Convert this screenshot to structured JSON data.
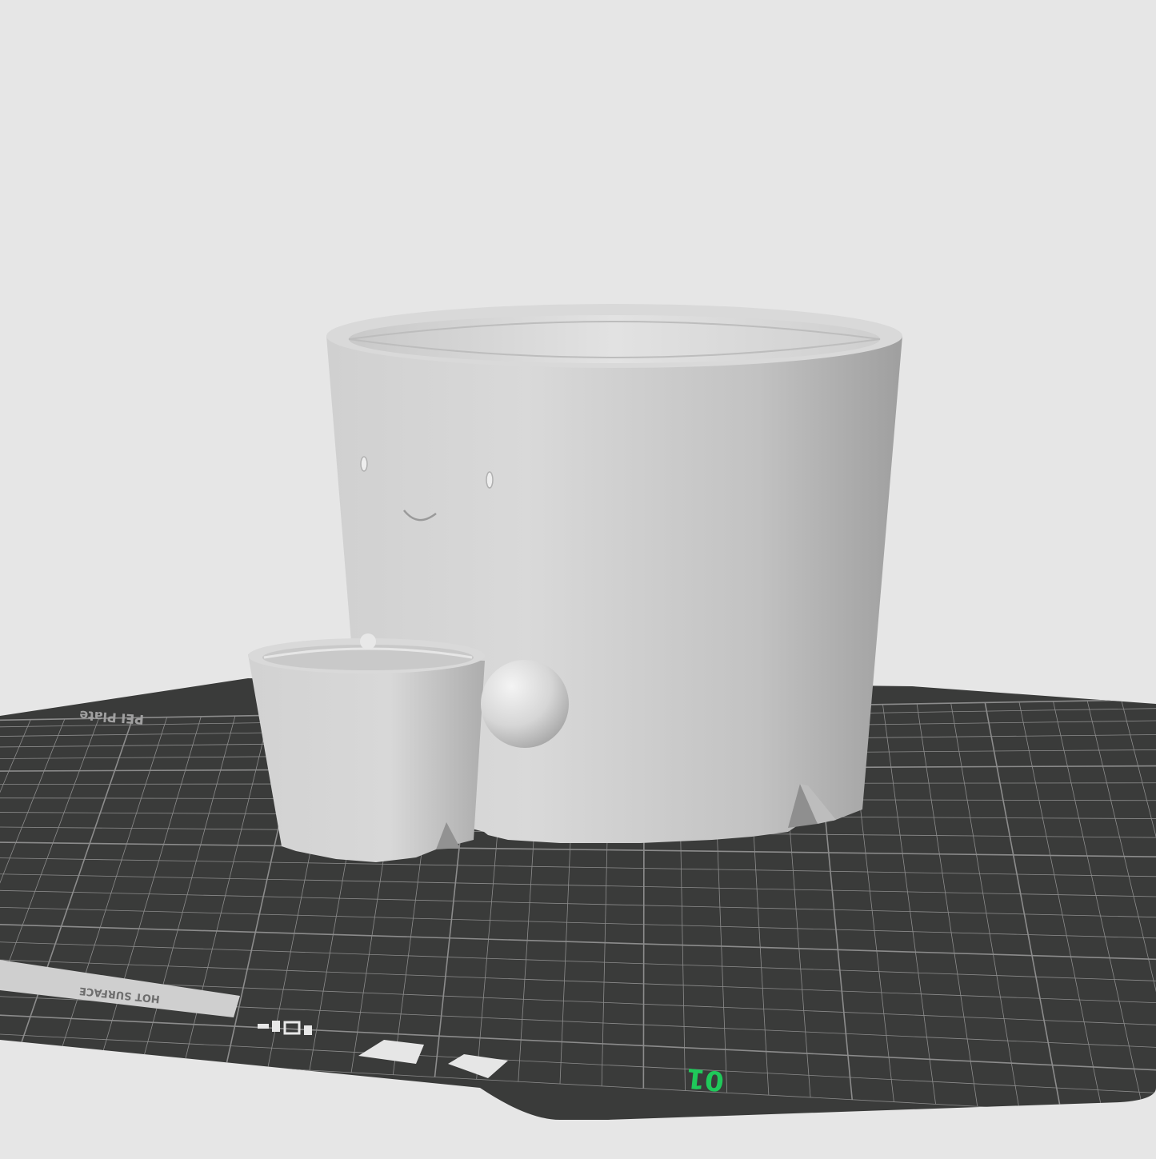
{
  "scene": {
    "background_color": "#e6e6e6",
    "bed_color": "#3a3b3a",
    "grid_color": "#8c8c8c",
    "model_color": "#d6d6d6"
  },
  "bed": {
    "plate_number": "01",
    "plate_number_color": "#1fc95a",
    "label_text": "HOT SURFACE",
    "engraved_text": "PEI Plate"
  },
  "objects": [
    {
      "name": "large-planter-pot",
      "features": [
        "eyes",
        "smile",
        "legs"
      ]
    },
    {
      "name": "small-planter-pot",
      "features": [
        "legs"
      ]
    },
    {
      "name": "ball",
      "features": []
    }
  ]
}
